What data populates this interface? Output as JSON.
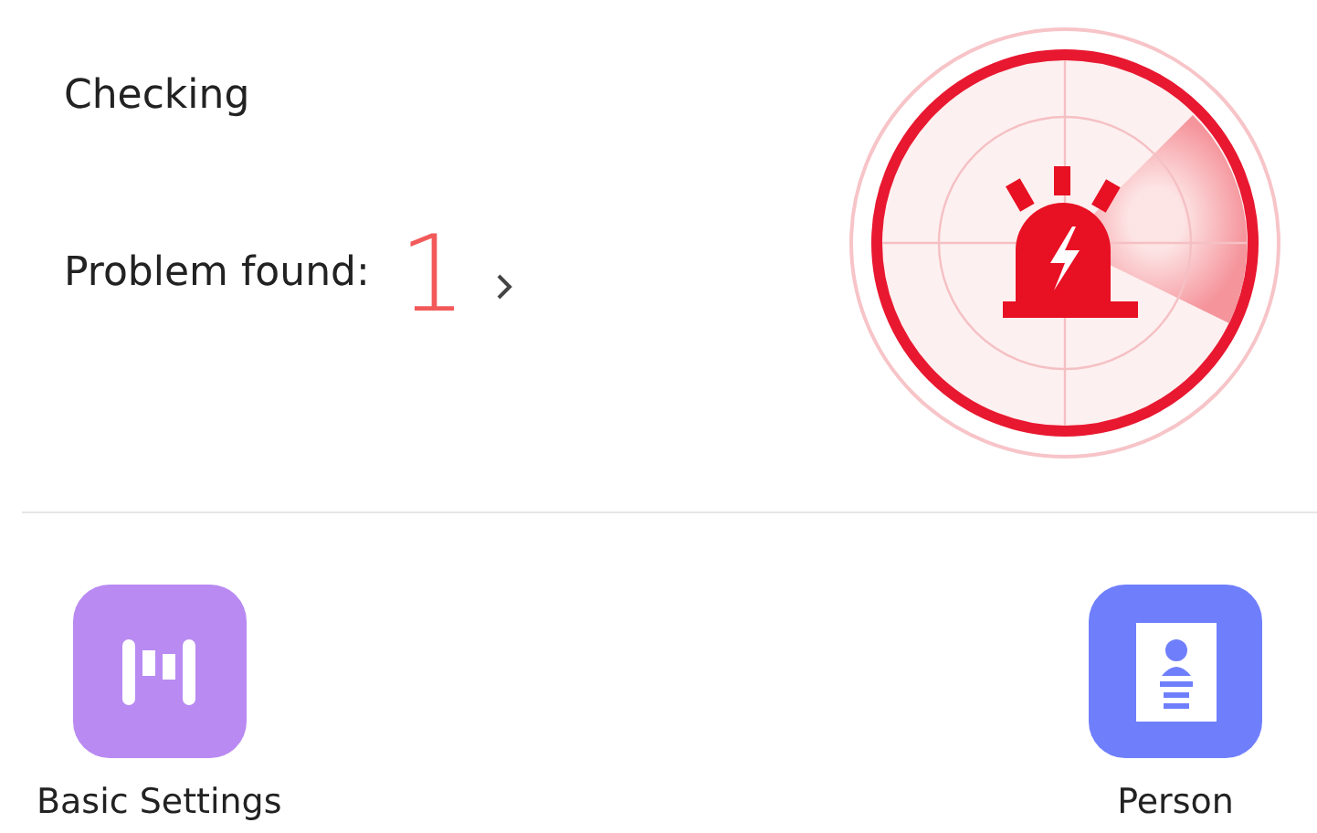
{
  "status": {
    "title": "Checking",
    "problems_label": "Problem found:",
    "problems_count": "1"
  },
  "shortcuts": [
    {
      "kind": "settings",
      "label": "Basic Settings",
      "color": "#b98af2"
    },
    {
      "kind": "person",
      "label": "Person",
      "color": "#6f7ffc"
    }
  ]
}
